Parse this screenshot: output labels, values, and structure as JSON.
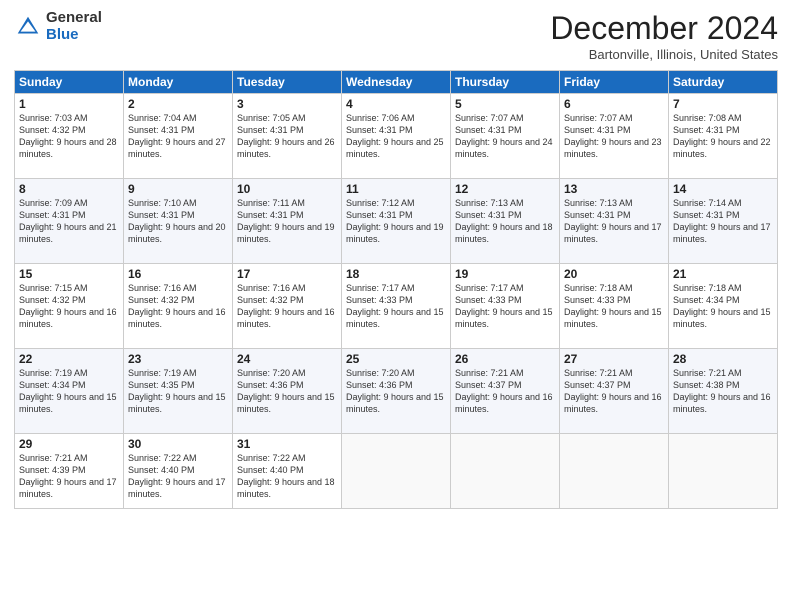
{
  "header": {
    "logo_general": "General",
    "logo_blue": "Blue",
    "month_title": "December 2024",
    "location": "Bartonville, Illinois, United States"
  },
  "weekdays": [
    "Sunday",
    "Monday",
    "Tuesday",
    "Wednesday",
    "Thursday",
    "Friday",
    "Saturday"
  ],
  "weeks": [
    [
      {
        "day": "1",
        "sunrise": "7:03 AM",
        "sunset": "4:32 PM",
        "daylight": "9 hours and 28 minutes."
      },
      {
        "day": "2",
        "sunrise": "7:04 AM",
        "sunset": "4:31 PM",
        "daylight": "9 hours and 27 minutes."
      },
      {
        "day": "3",
        "sunrise": "7:05 AM",
        "sunset": "4:31 PM",
        "daylight": "9 hours and 26 minutes."
      },
      {
        "day": "4",
        "sunrise": "7:06 AM",
        "sunset": "4:31 PM",
        "daylight": "9 hours and 25 minutes."
      },
      {
        "day": "5",
        "sunrise": "7:07 AM",
        "sunset": "4:31 PM",
        "daylight": "9 hours and 24 minutes."
      },
      {
        "day": "6",
        "sunrise": "7:07 AM",
        "sunset": "4:31 PM",
        "daylight": "9 hours and 23 minutes."
      },
      {
        "day": "7",
        "sunrise": "7:08 AM",
        "sunset": "4:31 PM",
        "daylight": "9 hours and 22 minutes."
      }
    ],
    [
      {
        "day": "8",
        "sunrise": "7:09 AM",
        "sunset": "4:31 PM",
        "daylight": "9 hours and 21 minutes."
      },
      {
        "day": "9",
        "sunrise": "7:10 AM",
        "sunset": "4:31 PM",
        "daylight": "9 hours and 20 minutes."
      },
      {
        "day": "10",
        "sunrise": "7:11 AM",
        "sunset": "4:31 PM",
        "daylight": "9 hours and 19 minutes."
      },
      {
        "day": "11",
        "sunrise": "7:12 AM",
        "sunset": "4:31 PM",
        "daylight": "9 hours and 19 minutes."
      },
      {
        "day": "12",
        "sunrise": "7:13 AM",
        "sunset": "4:31 PM",
        "daylight": "9 hours and 18 minutes."
      },
      {
        "day": "13",
        "sunrise": "7:13 AM",
        "sunset": "4:31 PM",
        "daylight": "9 hours and 17 minutes."
      },
      {
        "day": "14",
        "sunrise": "7:14 AM",
        "sunset": "4:31 PM",
        "daylight": "9 hours and 17 minutes."
      }
    ],
    [
      {
        "day": "15",
        "sunrise": "7:15 AM",
        "sunset": "4:32 PM",
        "daylight": "9 hours and 16 minutes."
      },
      {
        "day": "16",
        "sunrise": "7:16 AM",
        "sunset": "4:32 PM",
        "daylight": "9 hours and 16 minutes."
      },
      {
        "day": "17",
        "sunrise": "7:16 AM",
        "sunset": "4:32 PM",
        "daylight": "9 hours and 16 minutes."
      },
      {
        "day": "18",
        "sunrise": "7:17 AM",
        "sunset": "4:33 PM",
        "daylight": "9 hours and 15 minutes."
      },
      {
        "day": "19",
        "sunrise": "7:17 AM",
        "sunset": "4:33 PM",
        "daylight": "9 hours and 15 minutes."
      },
      {
        "day": "20",
        "sunrise": "7:18 AM",
        "sunset": "4:33 PM",
        "daylight": "9 hours and 15 minutes."
      },
      {
        "day": "21",
        "sunrise": "7:18 AM",
        "sunset": "4:34 PM",
        "daylight": "9 hours and 15 minutes."
      }
    ],
    [
      {
        "day": "22",
        "sunrise": "7:19 AM",
        "sunset": "4:34 PM",
        "daylight": "9 hours and 15 minutes."
      },
      {
        "day": "23",
        "sunrise": "7:19 AM",
        "sunset": "4:35 PM",
        "daylight": "9 hours and 15 minutes."
      },
      {
        "day": "24",
        "sunrise": "7:20 AM",
        "sunset": "4:36 PM",
        "daylight": "9 hours and 15 minutes."
      },
      {
        "day": "25",
        "sunrise": "7:20 AM",
        "sunset": "4:36 PM",
        "daylight": "9 hours and 15 minutes."
      },
      {
        "day": "26",
        "sunrise": "7:21 AM",
        "sunset": "4:37 PM",
        "daylight": "9 hours and 16 minutes."
      },
      {
        "day": "27",
        "sunrise": "7:21 AM",
        "sunset": "4:37 PM",
        "daylight": "9 hours and 16 minutes."
      },
      {
        "day": "28",
        "sunrise": "7:21 AM",
        "sunset": "4:38 PM",
        "daylight": "9 hours and 16 minutes."
      }
    ],
    [
      {
        "day": "29",
        "sunrise": "7:21 AM",
        "sunset": "4:39 PM",
        "daylight": "9 hours and 17 minutes."
      },
      {
        "day": "30",
        "sunrise": "7:22 AM",
        "sunset": "4:40 PM",
        "daylight": "9 hours and 17 minutes."
      },
      {
        "day": "31",
        "sunrise": "7:22 AM",
        "sunset": "4:40 PM",
        "daylight": "9 hours and 18 minutes."
      },
      null,
      null,
      null,
      null
    ]
  ]
}
